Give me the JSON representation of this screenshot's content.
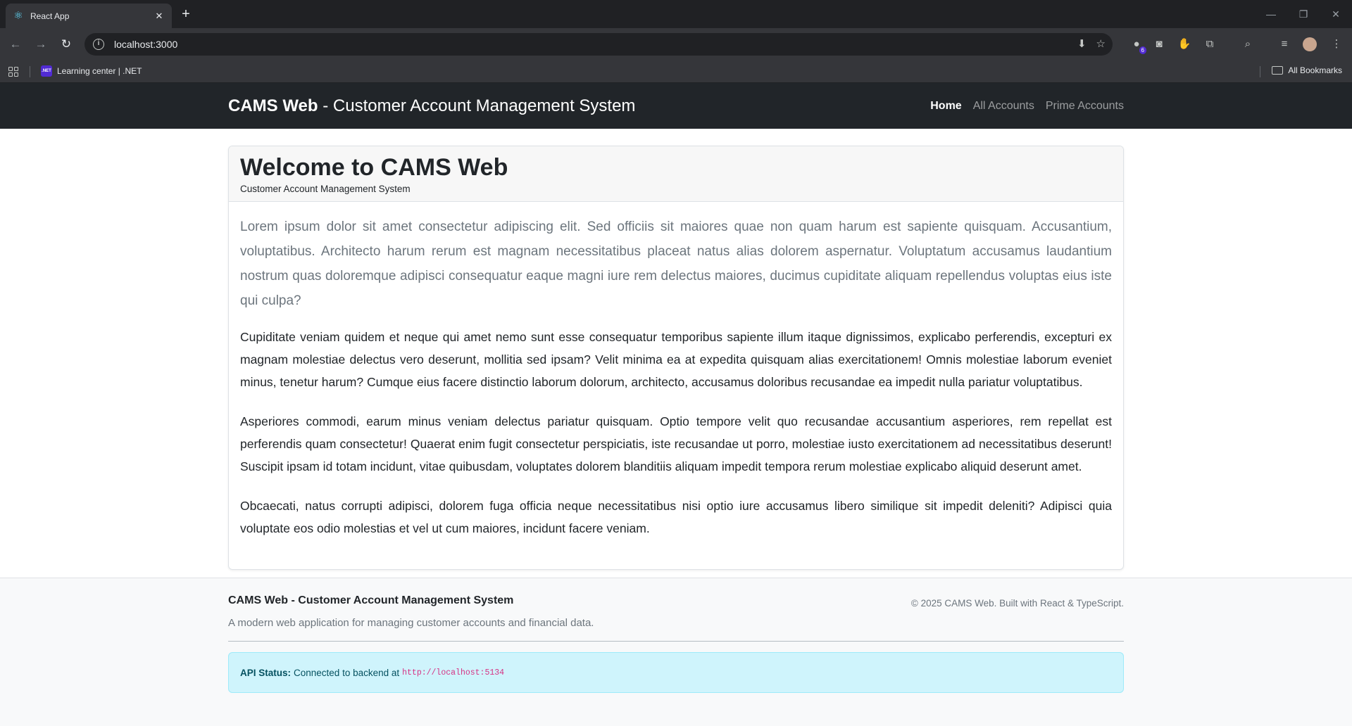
{
  "browser": {
    "tab_title": "React App",
    "new_tab": "+",
    "close": "✕",
    "url": "localhost:3000",
    "bookmark": "Learning center | .NET",
    "bookmark_badge": ".NET",
    "all_bookmarks": "All Bookmarks",
    "extension_badge": "6"
  },
  "navbar": {
    "brand_bold": "CAMS Web",
    "brand_rest": " - Customer Account Management System",
    "links": [
      "Home",
      "All Accounts",
      "Prime Accounts"
    ]
  },
  "card": {
    "title": "Welcome to CAMS Web",
    "subtitle": "Customer Account Management System",
    "lead": "Lorem ipsum dolor sit amet consectetur adipiscing elit. Sed officiis sit maiores quae non quam harum est sapiente quisquam. Accusantium, voluptatibus. Architecto harum rerum est magnam necessitatibus placeat natus alias dolorem aspernatur. Voluptatum accusamus laudantium nostrum quas doloremque adipisci consequatur eaque magni iure rem delectus maiores, ducimus cupiditate aliquam repellendus voluptas eius iste qui culpa?",
    "paragraphs": [
      "Cupiditate veniam quidem et neque qui amet nemo sunt esse consequatur temporibus sapiente illum itaque dignissimos, explicabo perferendis, excepturi ex magnam molestiae delectus vero deserunt, mollitia sed ipsam? Velit minima ea at expedita quisquam alias exercitationem! Omnis molestiae laborum eveniet minus, tenetur harum? Cumque eius facere distinctio laborum dolorum, architecto, accusamus doloribus recusandae ea impedit nulla pariatur voluptatibus.",
      "Asperiores commodi, earum minus veniam delectus pariatur quisquam. Optio tempore velit quo recusandae accusantium asperiores, rem repellat est perferendis quam consectetur! Quaerat enim fugit consectetur perspiciatis, iste recusandae ut porro, molestiae iusto exercitationem ad necessitatibus deserunt! Suscipit ipsam id totam incidunt, vitae quibusdam, voluptates dolorem blanditiis aliquam impedit tempora rerum molestiae explicabo aliquid deserunt amet.",
      "Obcaecati, natus corrupti adipisci, dolorem fuga officia neque necessitatibus nisi optio iure accusamus libero similique sit impedit deleniti? Adipisci quia voluptate eos odio molestias et vel ut cum maiores, incidunt facere veniam."
    ]
  },
  "footer": {
    "title": "CAMS Web - Customer Account Management System",
    "description": "A modern web application for managing customer accounts and financial data.",
    "copyright": "© 2025 CAMS Web. Built with React & TypeScript.",
    "api_label": "API Status:",
    "api_text": "Connected to backend at",
    "api_url": "http://localhost:5134"
  },
  "colors": {
    "navbar_bg": "#212529",
    "alert_bg": "#cff4fc",
    "code": "#d63384"
  }
}
